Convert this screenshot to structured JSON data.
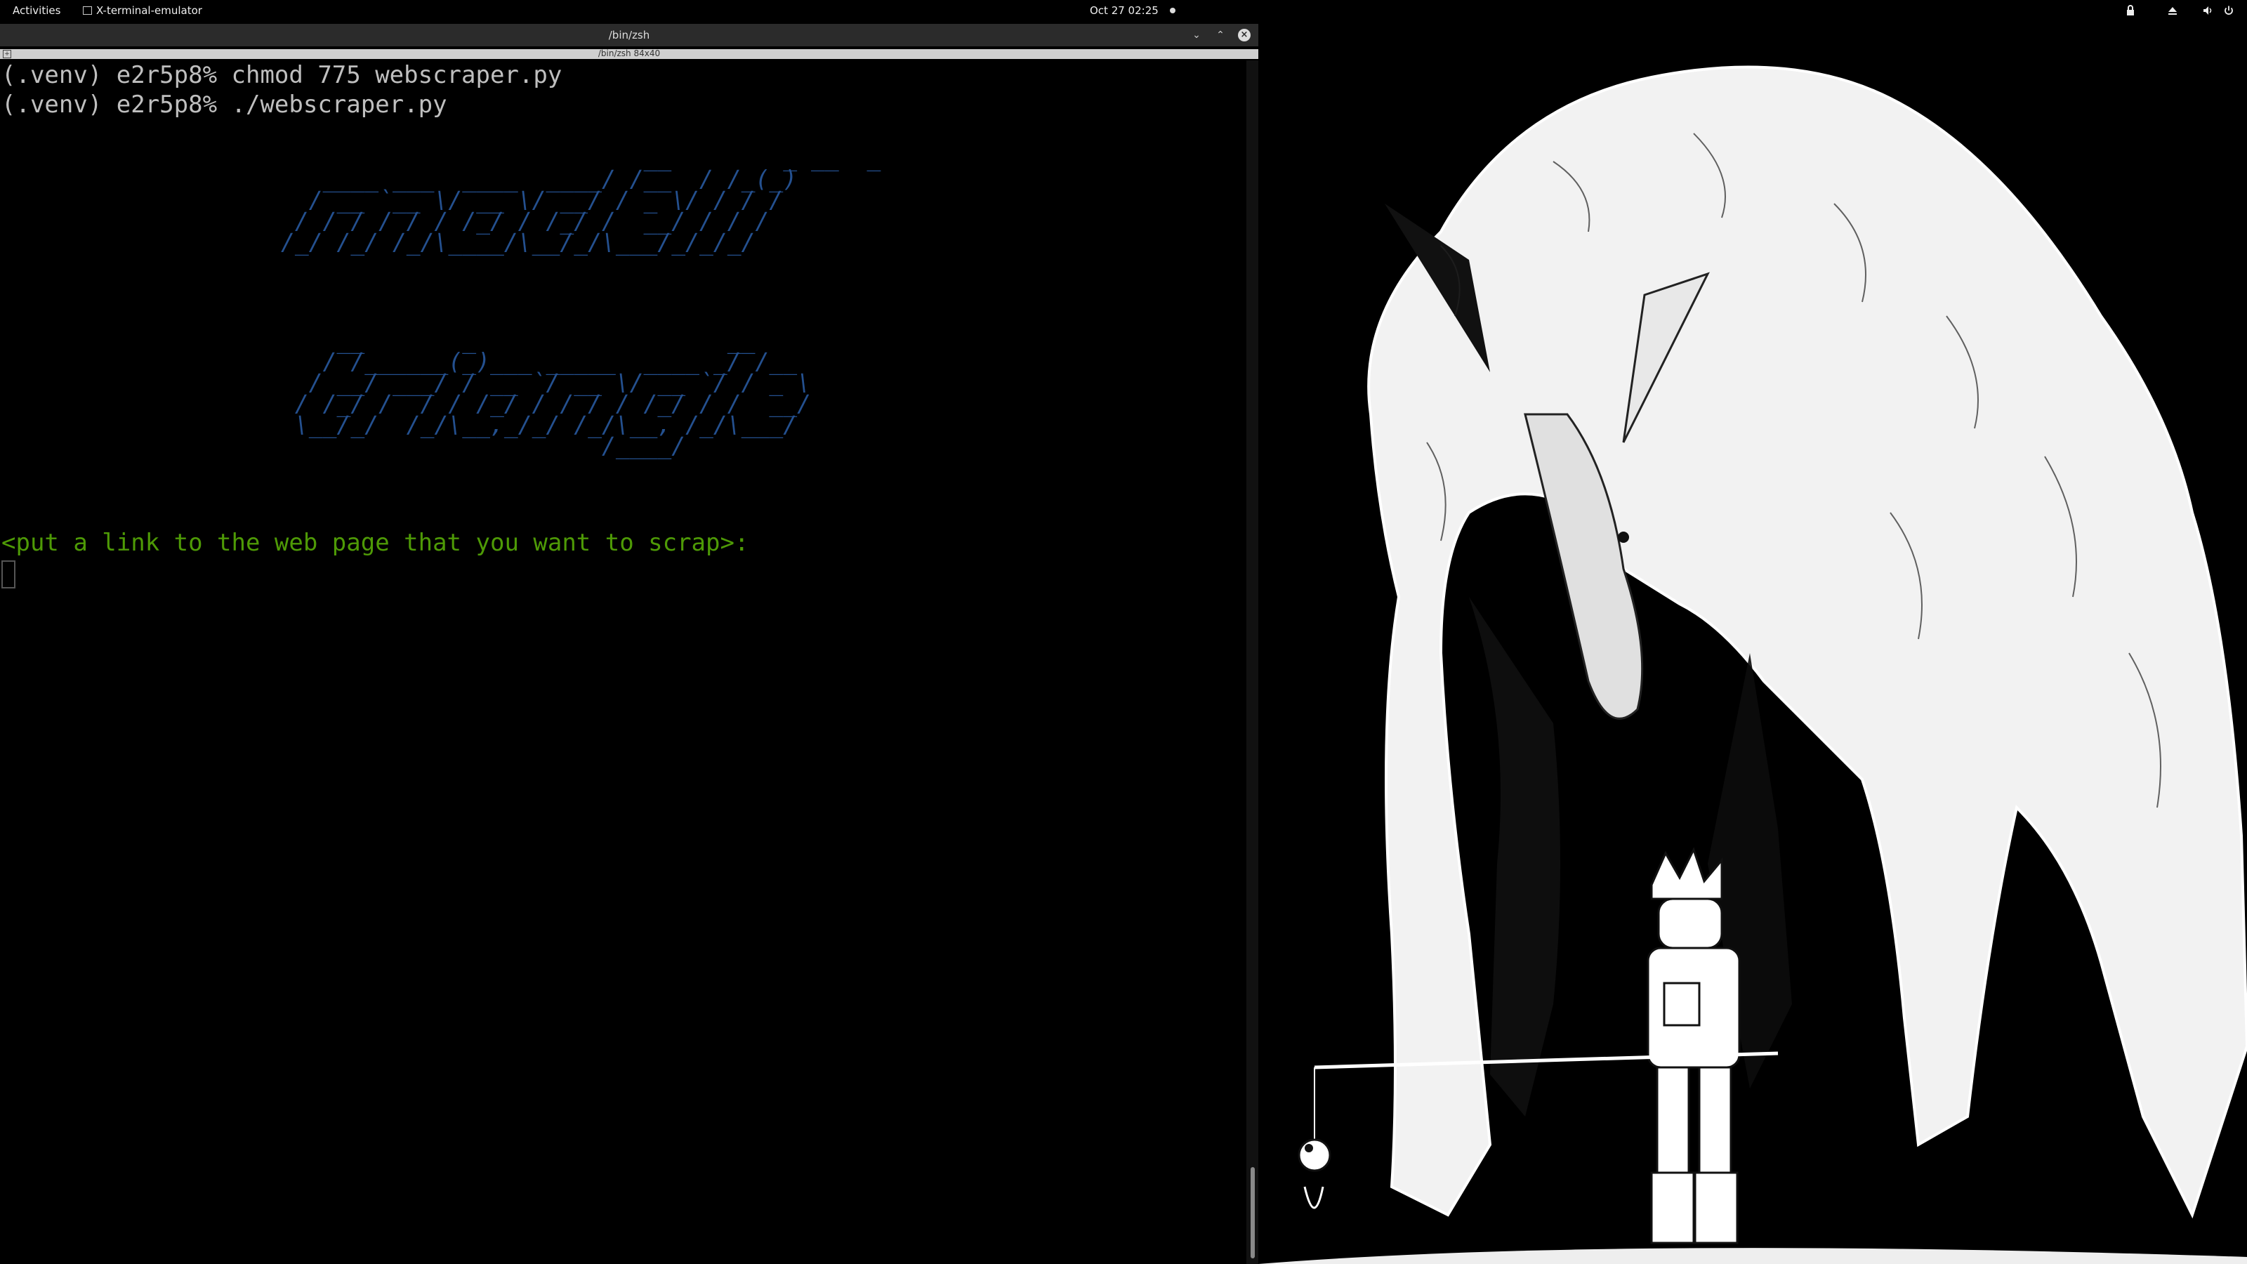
{
  "topbar": {
    "activities": "Activities",
    "app_name": "X-terminal-emulator",
    "clock": "Oct 27  02:25"
  },
  "window": {
    "title": "/bin/zsh",
    "tab_label": "/bin/zsh 84x40"
  },
  "terminal": {
    "line1": "(.venv) e2r5p8% chmod 775 webscraper.py",
    "line2": "(.venv) e2r5p8% ./webscraper.py",
    "banner1": "                          __        _ __  _ \n   ____ ___  ____  ____/ /__  / /_(_)\n  / __ `__ \\/ __ \\/ __/ / _ \\/ / / / \n / / / / / / /_/ / /_/ /  __/ / / /  \n/_/ /_/ /_/\\____/\\__/_/\\___/_/_/_/   ",
    "banner2": "    __       _                  __    \n   / /______(_)___ _____  ____ _/ /__  \n  / __/ ___/ / __ `/ __ \\/ __ `/ / _ \\ \n / /_/ /  / / /_/ / / / / /_/ / /  __/ \n \\__/_/  /_/\\__,_/_/ /_/\\__, /_/\\___/  \n                       /____/          ",
    "prompt": "<put a link to the web page that you want to scrap>:"
  },
  "colors": {
    "banner": "#24508f",
    "prompt": "#4e9a06",
    "text": "#bfbfbf",
    "background": "#000000"
  },
  "icons": {
    "tray": [
      "lock-icon",
      "eject-icon",
      "volume-icon",
      "power-icon"
    ],
    "window": [
      "minimize-icon",
      "maximize-icon",
      "close-icon"
    ]
  }
}
